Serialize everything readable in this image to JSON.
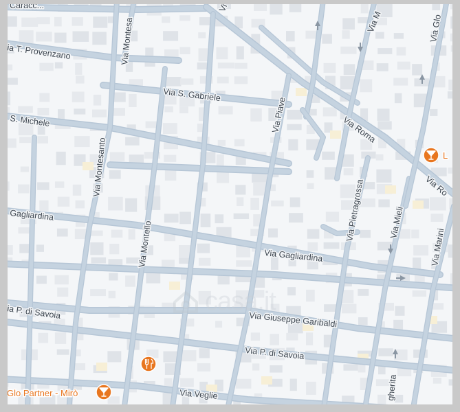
{
  "map": {
    "watermark": "casa.it",
    "colors": {
      "background": "#f4f6f8",
      "block": "#e6e9ed",
      "block_dark": "#dfe3e8",
      "road": "#c5d3e0",
      "road_edge": "#b6c6d6",
      "frame": "#c9c9c9",
      "poi": "#e8761f",
      "label": "#3d4650"
    },
    "street_labels": {
      "via_caracciolo_fragment": "Caracc...",
      "via_t_provenzano": "Via T. Provenzano",
      "via_montesanto_top": "Via Montesa",
      "via_s_gabriele": "Via S. Gabriele",
      "via_s_michele": "S. Michele",
      "via_piave": "Via Piave",
      "via_roma": "Via Roma",
      "via_roma_right": "Via Ro",
      "via_montesanto": "Via Montesanto",
      "via_montello": "Via Montello",
      "via_pietragrossa": "Via Pietragrossa",
      "via_mieli": "Via Mieli",
      "via_marini": "Via Marini",
      "via_gagliardina_left": "Gagliardina",
      "via_gagliardina": "Via Gagliardina",
      "via_p_di_savoia_left": "Via P. di Savoia",
      "via_giuseppe_garibaldi": "Via Giuseppe Garibaldi",
      "via_p_di_savoia": "Via P. di Savoia",
      "via_veglie": "Via Veglie",
      "via_margherita": "gherita",
      "via_top_v": "Vi",
      "via_top_m": "Via M",
      "via_top_glo": "Via Glo"
    },
    "pois": {
      "glo_partner": "Glo Partner - Mirò",
      "bar_right_label": "L",
      "bar_right_icon": "cocktail-icon",
      "restaurant_icon": "fork-knife-icon",
      "glo_icon": "cocktail-icon"
    }
  }
}
